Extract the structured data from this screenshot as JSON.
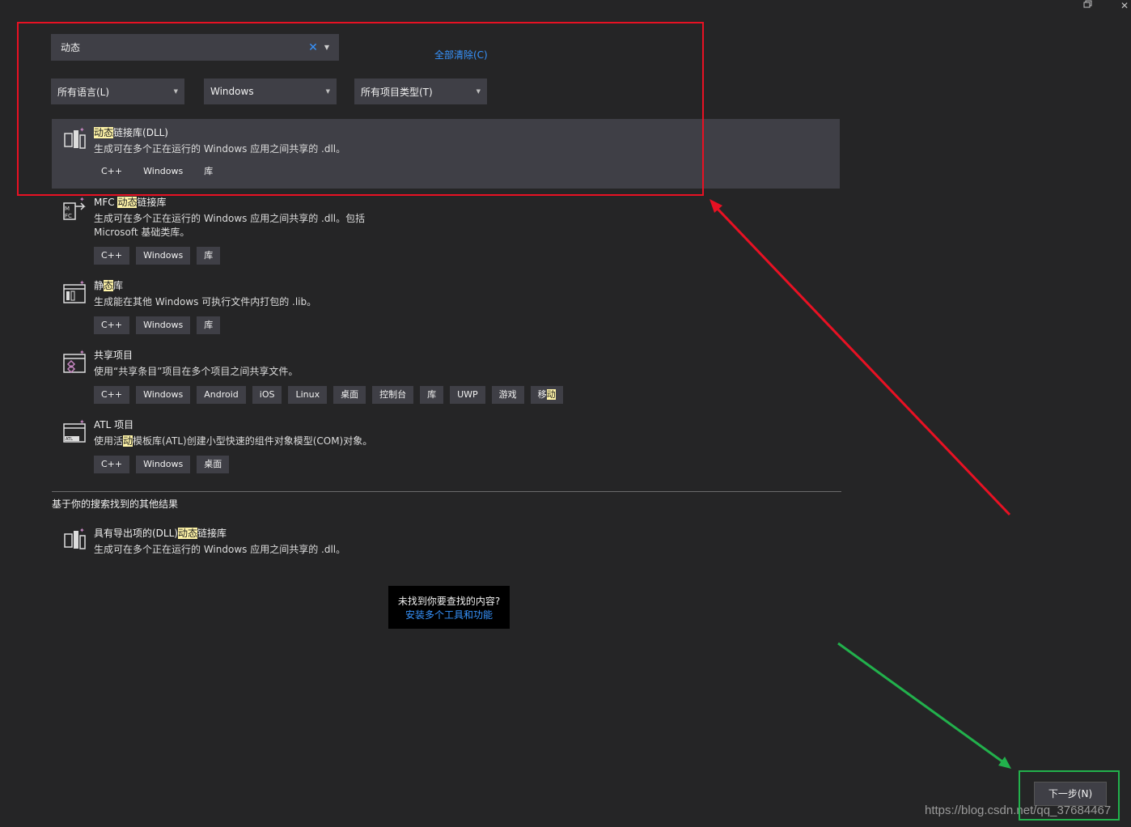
{
  "search": {
    "value": "动态",
    "clear_icon": "clear-x-icon",
    "dropdown_icon": "caret-down-icon"
  },
  "clear_all": "全部清除(C)",
  "filters": [
    {
      "label": "所有语言(L)"
    },
    {
      "label": "Windows"
    },
    {
      "label": "所有项目类型(T)"
    }
  ],
  "results": [
    {
      "title_pre": "",
      "title_hl": "动态",
      "title_post": "链接库(DLL)",
      "desc": "生成可在多个正在运行的 Windows 应用之间共享的 .dll。",
      "tags": [
        "C++",
        "Windows",
        "库"
      ],
      "icon": "dll-project-icon"
    },
    {
      "title_pre": "MFC ",
      "title_hl": "动态",
      "title_post": "链接库",
      "desc": "生成可在多个正在运行的 Windows 应用之间共享的 .dll。包括 Microsoft 基础类库。",
      "tags": [
        "C++",
        "Windows",
        "库"
      ],
      "icon": "mfc-dll-project-icon"
    },
    {
      "title_pre": "静",
      "title_hl": "态",
      "title_post": "库",
      "desc": "生成能在其他 Windows 可执行文件内打包的 .lib。",
      "tags": [
        "C++",
        "Windows",
        "库"
      ],
      "icon": "static-lib-project-icon"
    },
    {
      "title_pre": "共享项目",
      "title_hl": "",
      "title_post": "",
      "desc": "使用“共享条目”项目在多个项目之间共享文件。",
      "tags": [
        "C++",
        "Windows",
        "Android",
        "iOS",
        "Linux",
        "桌面",
        "控制台",
        "库",
        "UWP",
        "游戏"
      ],
      "last_tag_pre": "移",
      "last_tag_hl": "动",
      "icon": "shared-project-icon"
    },
    {
      "title_pre": "ATL 项目",
      "title_hl": "",
      "title_post": "",
      "desc_pre": "使用活",
      "desc_hl": "动",
      "desc_post": "模板库(ATL)创建小型快速的组件对象模型(COM)对象。",
      "tags": [
        "C++",
        "Windows",
        "桌面"
      ],
      "icon": "atl-project-icon"
    }
  ],
  "other_section": {
    "label": "基于你的搜索找到的其他结果",
    "item": {
      "title_pre": "具有导出项的(DLL)",
      "title_hl": "动态",
      "title_post": "链接库",
      "desc": "生成可在多个正在运行的 Windows 应用之间共享的 .dll。",
      "icon": "dll-exports-project-icon"
    }
  },
  "not_found": {
    "line1": "未找到你要查找的内容?",
    "link": "安装多个工具和功能"
  },
  "next_button": "下一步(N)",
  "watermark": "https://blog.csdn.net/qq_37684467",
  "colors": {
    "background": "#252526",
    "panel": "#3f3f46",
    "link": "#3794ff",
    "highlight": "#fff4a8",
    "annotation_red": "#e81123",
    "annotation_green": "#22b14c"
  }
}
